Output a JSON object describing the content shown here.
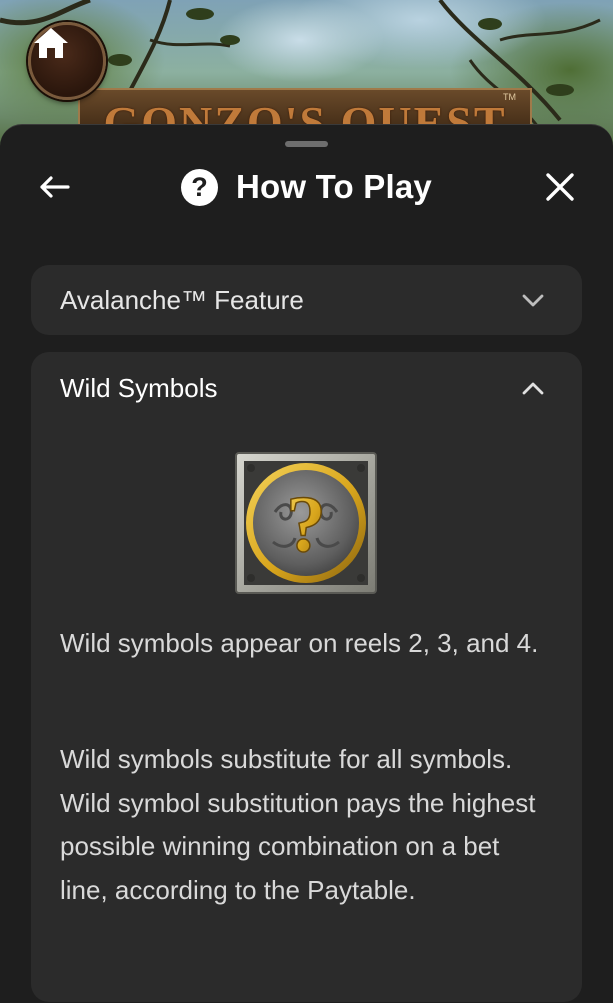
{
  "game": {
    "logo_text": "GONZO'S QUEST",
    "logo_tm": "TM",
    "home_icon": "home-icon"
  },
  "sheet": {
    "title": "How To Play",
    "help_icon_glyph": "?",
    "back_icon": "arrow-left-icon",
    "close_icon": "close-icon"
  },
  "sections": [
    {
      "label": "Avalanche™ Feature",
      "expanded": false,
      "chevron_icon": "chevron-down-icon"
    },
    {
      "label": "Wild Symbols",
      "expanded": true,
      "chevron_icon": "chevron-up-icon",
      "image_icon": "wild-symbol-icon",
      "image_glyph": "?",
      "paragraphs": [
        "Wild symbols appear on reels 2, 3, and 4.",
        "Wild symbols substitute for all symbols. Wild symbol substitution pays the highest possible winning combination on a bet line, according to the Paytable."
      ]
    }
  ],
  "colors": {
    "sheet_bg": "#1e1e1e",
    "card_bg": "#2b2b2b",
    "text_primary": "#ffffff",
    "text_secondary": "#d9d9d9",
    "wild_gold": "#d8a51c"
  }
}
